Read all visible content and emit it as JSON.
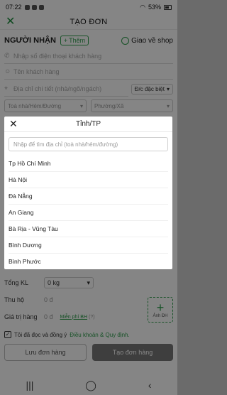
{
  "status": {
    "time": "07:22",
    "battery": "53%"
  },
  "header": {
    "title": "TẠO ĐƠN"
  },
  "receiver": {
    "label": "NGƯỜI NHẬN",
    "add_label": "Thêm",
    "ship_option": "Giao về shop"
  },
  "form": {
    "phone_placeholder": "Nhập số điện thoại khách hàng",
    "name_placeholder": "Tên khách hàng",
    "address_placeholder": "Địa chỉ chi tiết (nhà/ngõ/ngách)",
    "special_label": "Đ/c đặc biệt",
    "building_placeholder": "Toà nhà/Hẻm/Đường",
    "ward_placeholder": "Phường/Xã"
  },
  "modal": {
    "title": "Tỉnh/TP",
    "search_placeholder": "Nhập để tìm địa chỉ (toà nhà/hẻm/đường)",
    "items": [
      "Tp Hồ Chí Minh",
      "Hà Nội",
      "Đà Nẵng",
      "An Giang",
      "Bà Rịa - Vũng Tàu",
      "Bình Dương",
      "Bình Phước"
    ]
  },
  "order": {
    "weight_label": "Tổng KL",
    "weight_value": "0 kg",
    "cod_label": "Thu hộ",
    "cod_value": "0 đ",
    "value_label": "Giá trị hàng",
    "value_value": "0 đ",
    "insurance_link": "Miễn phí BH",
    "insurance_q": "(?)",
    "photo_label": "Ảnh ĐH"
  },
  "agree": {
    "text": "Tôi đã đọc và đồng ý",
    "terms": "Điều khoản & Quy định."
  },
  "actions": {
    "save": "Lưu đơn hàng",
    "create": "Tạo đơn hàng"
  },
  "colors": {
    "accent": "#2e9d4c",
    "overlay": "rgba(0,0,0,0.48)"
  }
}
